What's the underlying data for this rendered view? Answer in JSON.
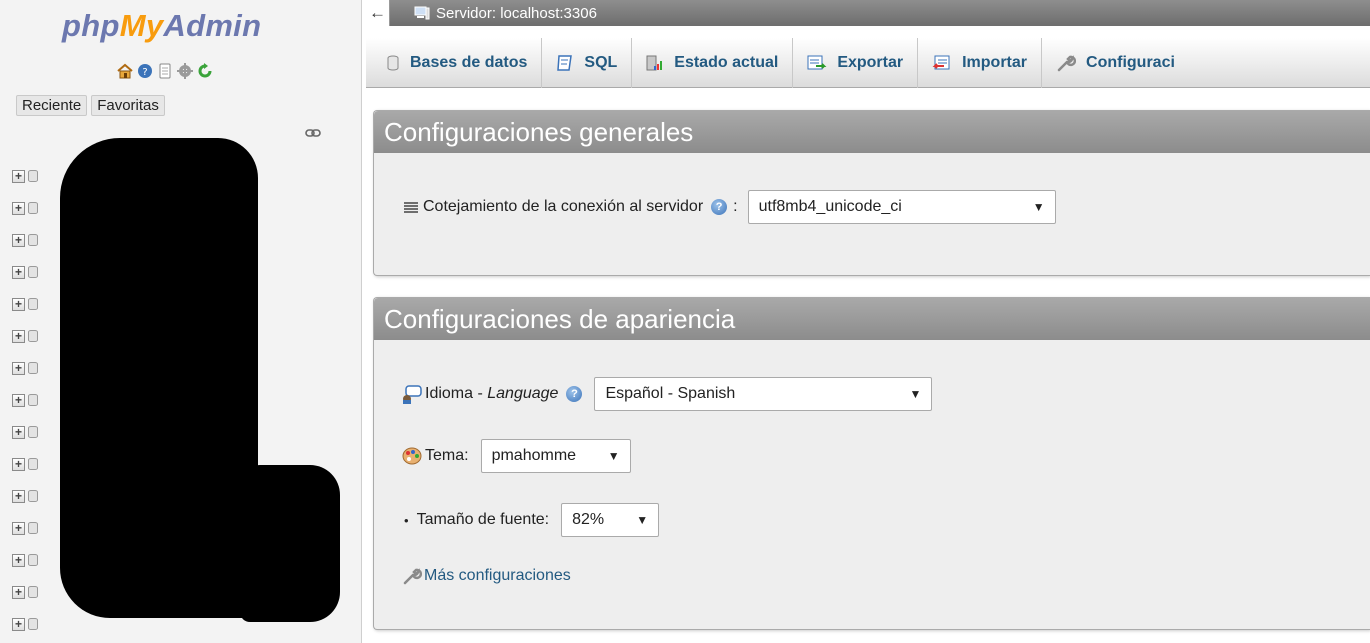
{
  "nav": {
    "logo": {
      "php": "php",
      "my": "My",
      "admin": "Admin"
    },
    "icons": [
      "home-icon",
      "help-icon",
      "docs-icon",
      "settings-icon",
      "reload-icon"
    ],
    "tabs": {
      "recent": "Reciente",
      "favorites": "Favoritas"
    },
    "db_rows": 15
  },
  "serverbar": {
    "back": "←",
    "server": "Servidor: localhost:3306"
  },
  "menu": {
    "items": [
      {
        "label": "Bases de datos",
        "icon": "database-icon"
      },
      {
        "label": "SQL",
        "icon": "sql-icon"
      },
      {
        "label": "Estado actual",
        "icon": "status-chart-icon"
      },
      {
        "label": "Exportar",
        "icon": "export-icon"
      },
      {
        "label": "Importar",
        "icon": "import-icon"
      },
      {
        "label": "Configuraci",
        "icon": "wrench-icon"
      }
    ]
  },
  "general": {
    "title": "Configuraciones generales",
    "collation_label": "Cotejamiento de la conexión al servidor",
    "collation_value": "utf8mb4_unicode_ci"
  },
  "appearance": {
    "title": "Configuraciones de apariencia",
    "language_label": "Idioma - ",
    "language_label_en": "Language",
    "language_value": "Español - Spanish",
    "theme_label": "Tema:",
    "theme_value": "pmahomme",
    "font_label": "Tamaño de fuente:",
    "font_value": "82%",
    "more_settings": "Más configuraciones"
  },
  "colors": {
    "link": "#235a81",
    "header_gray": "#999999",
    "logo_blue": "#6c78af",
    "logo_orange": "#f89c0e"
  }
}
